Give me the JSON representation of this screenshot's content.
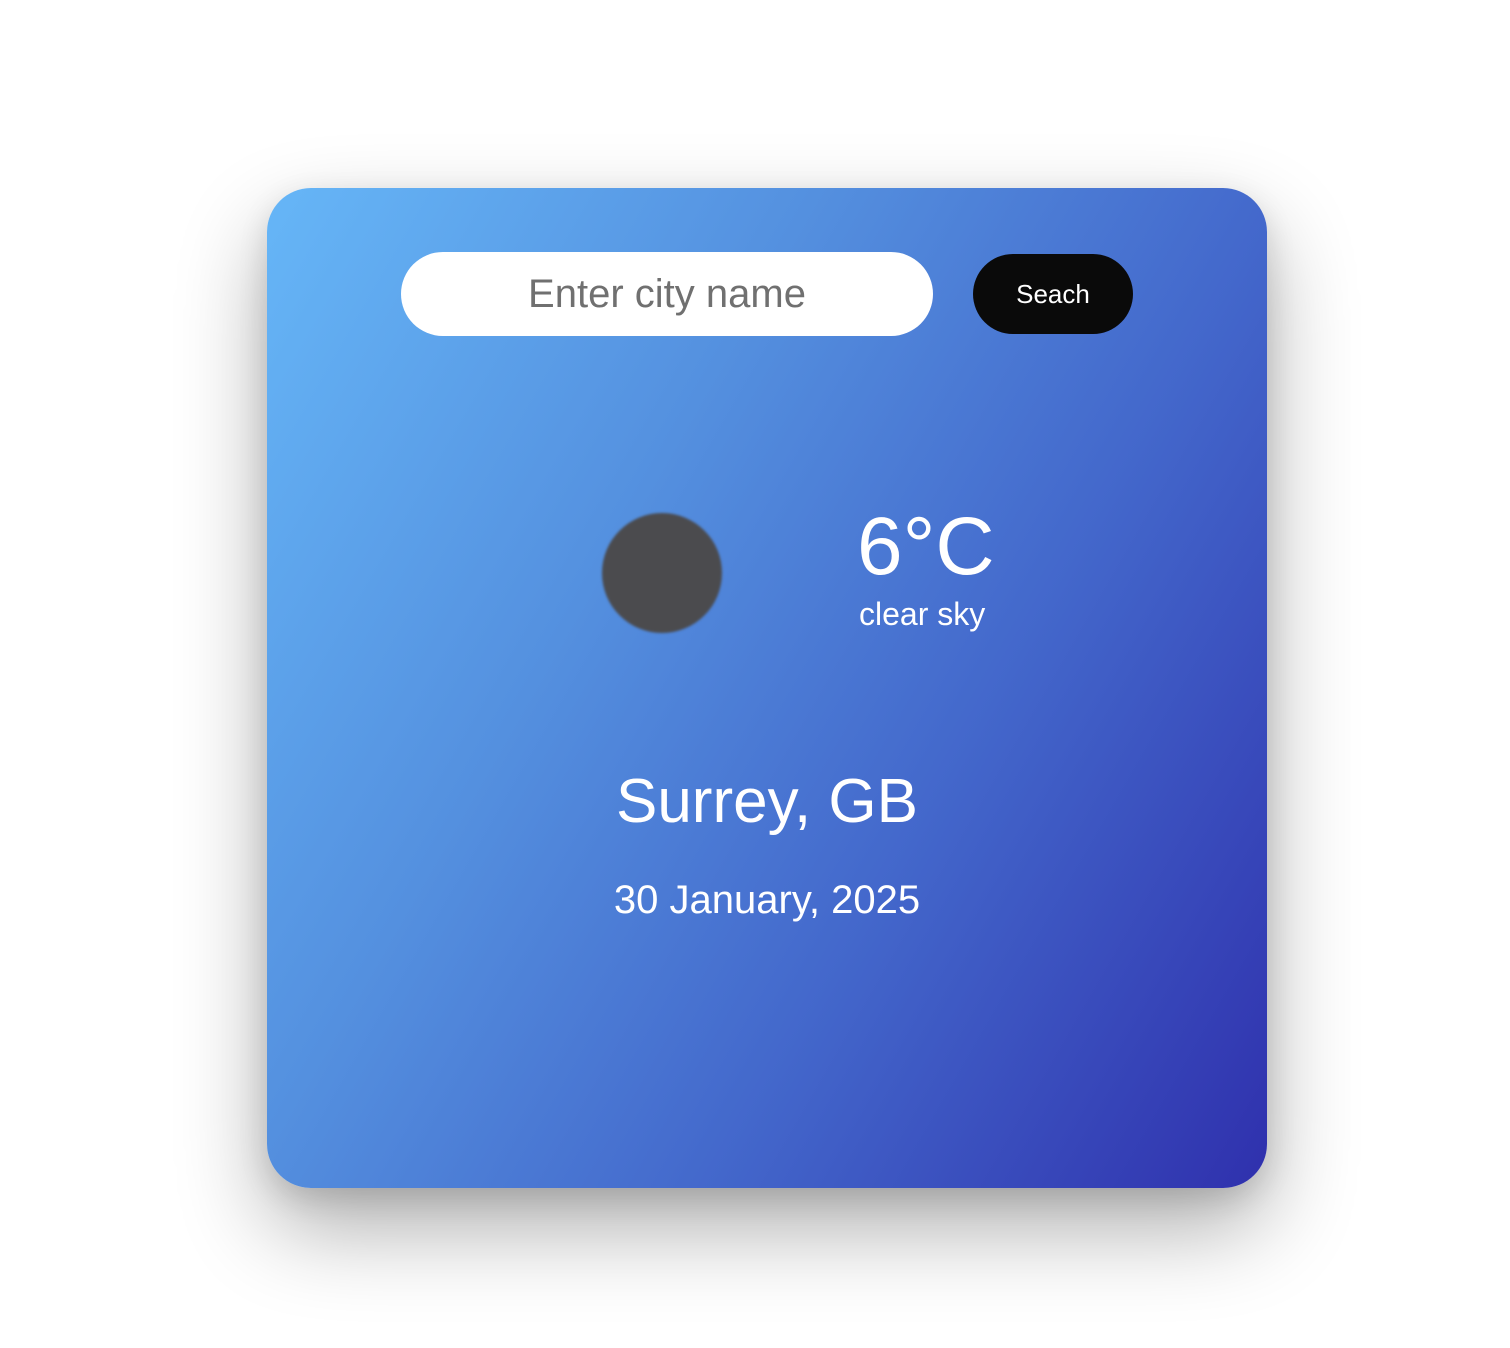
{
  "search": {
    "placeholder": "Enter city name",
    "value": "",
    "button_label": "Seach"
  },
  "weather": {
    "icon": "weather-icon",
    "temperature": "6°C",
    "description": "clear sky",
    "location": "Surrey, GB",
    "date": "30 January, 2025"
  },
  "colors": {
    "gradient_start": "#66b6f7",
    "gradient_end": "#2f30ad",
    "button_bg": "#0a0a0a",
    "icon_placeholder": "#4b4b4e"
  }
}
